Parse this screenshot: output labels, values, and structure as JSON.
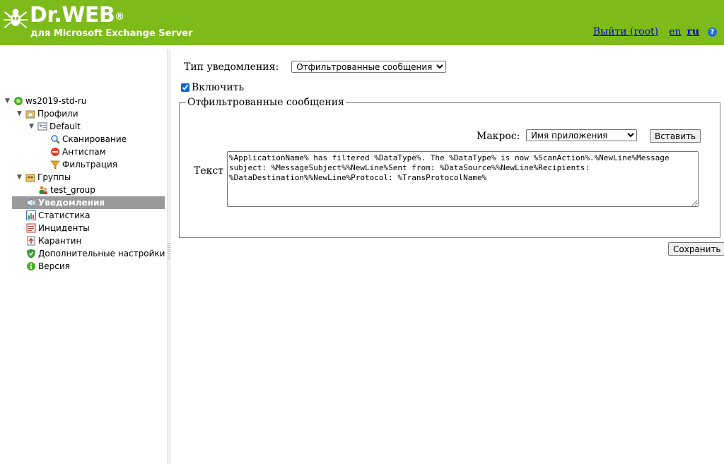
{
  "header": {
    "brand": "Dr.WEB",
    "brand_mark": "®",
    "subtitle": "для Microsoft Exchange Server",
    "logout_label": "Выйти (root)",
    "lang_en": "en",
    "lang_ru": "ru",
    "help_glyph": "?",
    "color": "#7dbb1b"
  },
  "sidebar": {
    "items": [
      {
        "label": "ws2019-std-ru",
        "icon": "server-icon"
      },
      {
        "label": "Профили",
        "icon": "profiles-folder-icon"
      },
      {
        "label": "Default",
        "icon": "profile-card-icon"
      },
      {
        "label": "Сканирование",
        "icon": "magnifier-icon"
      },
      {
        "label": "Антиспам",
        "icon": "antispam-icon"
      },
      {
        "label": "Фильтрация",
        "icon": "filter-funnel-icon"
      },
      {
        "label": "Группы",
        "icon": "groups-folder-icon"
      },
      {
        "label": "test_group",
        "icon": "group-users-icon"
      },
      {
        "label": "Уведомления",
        "icon": "notifications-icon"
      },
      {
        "label": "Статистика",
        "icon": "statistics-icon"
      },
      {
        "label": "Инциденты",
        "icon": "incidents-icon"
      },
      {
        "label": "Карантин",
        "icon": "quarantine-icon"
      },
      {
        "label": "Дополнительные настройки",
        "icon": "shield-settings-icon"
      },
      {
        "label": "Версия",
        "icon": "info-icon"
      }
    ],
    "selected_color": "#9a9a9a"
  },
  "main": {
    "notification_type_label": "Тип уведомления:",
    "notification_type_value": "Отфильтрованные сообщения",
    "enable_label": "Включить",
    "enable_checked": true,
    "fieldset_title": "Отфильтрованные сообщения",
    "macro_label": "Макрос:",
    "macro_value": "Имя приложения",
    "insert_label": "Вставить",
    "text_label": "Текст",
    "text_value": "%ApplicationName% has filtered %DataType%. The %DataType% is now %ScanAction%.%NewLine%Message subject: %MessageSubject%%NewLine%Sent from: %DataSource%%NewLine%Recipients: %DataDestination%%NewLine%Protocol: %TransProtocolName%",
    "save_label": "Сохранить"
  }
}
